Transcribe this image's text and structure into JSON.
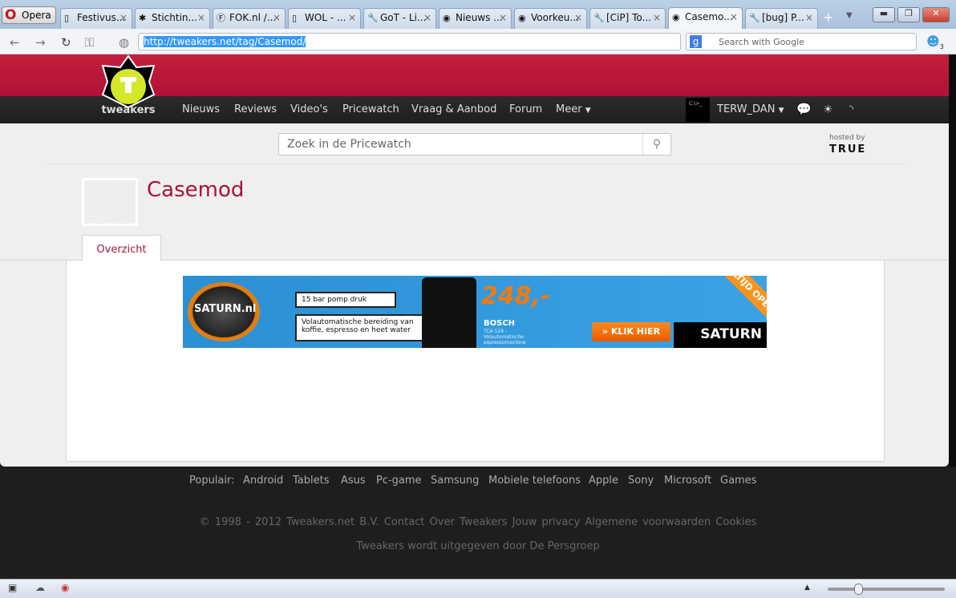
{
  "browser": {
    "menu_label": "Opera",
    "tabs": [
      {
        "label": "Festivus...",
        "icon": "page-icon"
      },
      {
        "label": "Stichtin...",
        "icon": "palm-icon"
      },
      {
        "label": "FOK.nl /...",
        "icon": "fok-icon"
      },
      {
        "label": "WOL - ...",
        "icon": "page-icon"
      },
      {
        "label": "GoT - Li...",
        "icon": "wrench-icon"
      },
      {
        "label": "Nieuws ...",
        "icon": "tweakers-icon"
      },
      {
        "label": "Voorkeu...",
        "icon": "tweakers-icon"
      },
      {
        "label": "[CiP] To...",
        "icon": "wrench-icon"
      },
      {
        "label": "Casemo...",
        "icon": "tweakers-icon",
        "active": true
      },
      {
        "label": "[bug] P...",
        "icon": "wrench-icon"
      }
    ],
    "url": "http://tweakers.net/tag/Casemod/",
    "search_placeholder": "Search with Google",
    "badge": "3"
  },
  "site": {
    "logo_text": "tweakers",
    "nav": [
      "Nieuws",
      "Reviews",
      "Video's",
      "Pricewatch",
      "Vraag & Aanbod",
      "Forum",
      "Meer"
    ],
    "avatar_text": "C:\\>_",
    "username": "TERW_DAN",
    "search_placeholder": "Zoek in de Pricewatch",
    "hosted_by": "hosted by",
    "host_logo": "TRUE",
    "page_title": "Casemod",
    "tab": "Overzicht"
  },
  "ad": {
    "brand": "SATURN.nl",
    "line1": "15 bar pomp druk",
    "line2": "Volautomatische bereiding van koffie, espresso en heet water",
    "price": "248,-",
    "product_brand": "BOSCH",
    "product": "TCA 529 - Volautomatische espressomachine",
    "cta": "» KLIK HIER",
    "corner": "ALTIJD OPEN!",
    "logo": "SATURN"
  },
  "footer": {
    "popular_label": "Populair:",
    "popular": [
      "Android",
      "Tablets",
      "Asus",
      "Pc-game",
      "Samsung",
      "Mobiele telefoons",
      "Apple",
      "Sony",
      "Microsoft",
      "Games"
    ],
    "copyright": "© 1998 - 2012 Tweakers.net B.V.",
    "links": [
      "Contact",
      "Over Tweakers",
      "Jouw privacy",
      "Algemene voorwaarden",
      "Cookies"
    ],
    "publisher": "Tweakers wordt uitgegeven door De Persgroep"
  }
}
